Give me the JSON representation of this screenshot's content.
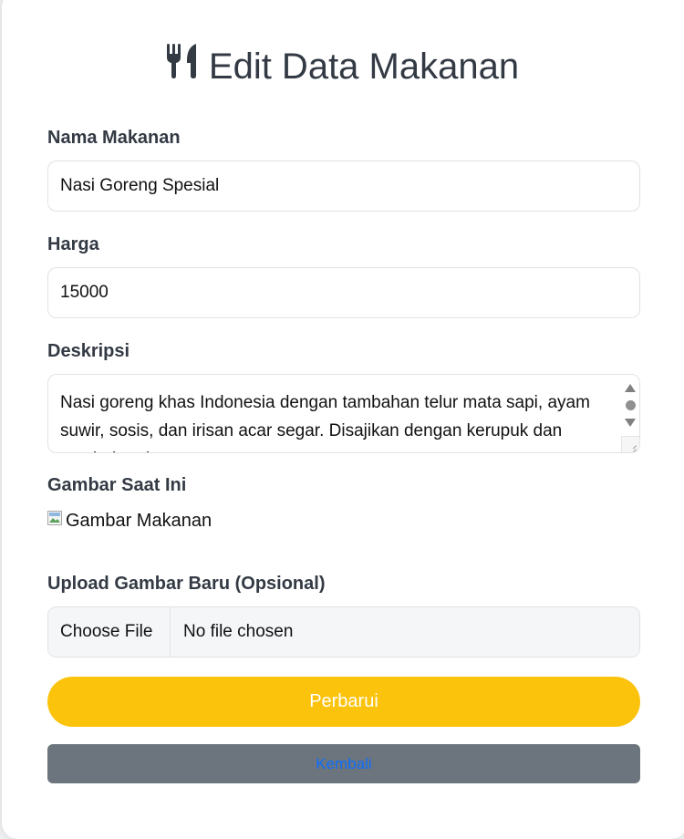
{
  "page": {
    "title": "Edit Data Makanan",
    "title_icon": "utensils-icon"
  },
  "form": {
    "name": {
      "label": "Nama Makanan",
      "value": "Nasi Goreng Spesial"
    },
    "price": {
      "label": "Harga",
      "value": "15000"
    },
    "description": {
      "label": "Deskripsi",
      "value": "Nasi goreng khas Indonesia dengan tambahan telur mata sapi, ayam suwir, sosis, dan irisan acar segar. Disajikan dengan kerupuk dan sambal pedas."
    },
    "current_image": {
      "label": "Gambar Saat Ini",
      "alt": "Gambar Makanan",
      "icon": "broken-image-icon"
    },
    "upload": {
      "label": "Upload Gambar Baru (Opsional)",
      "button_label": "Choose File",
      "status": "No file chosen"
    }
  },
  "actions": {
    "update_label": "Perbarui",
    "back_label": "Kembali"
  },
  "colors": {
    "update_button": "#fcc30d",
    "back_button": "#6c757d",
    "back_link_text": "#0d6efd",
    "heading_text": "#333a44"
  }
}
